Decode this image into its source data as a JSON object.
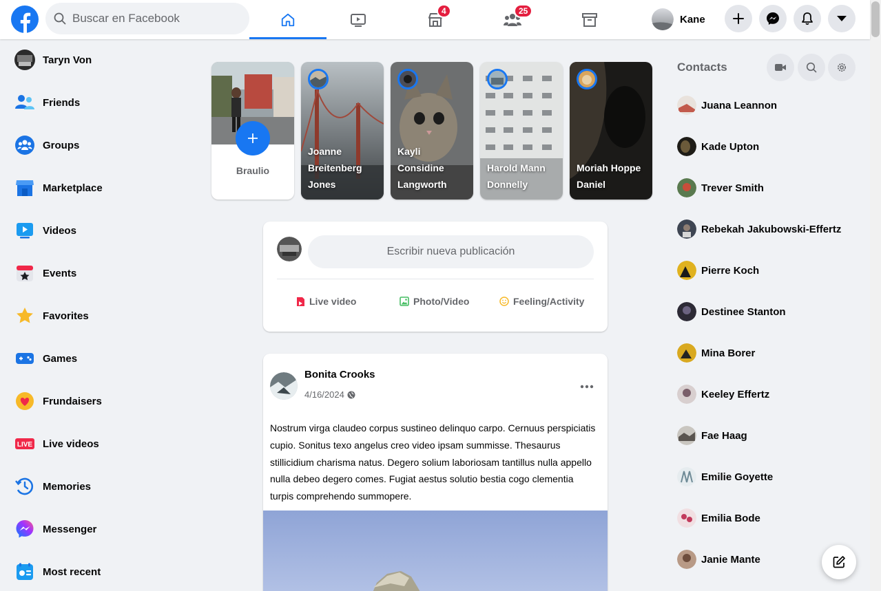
{
  "topbar": {
    "logo_icon": "facebook-logo-icon",
    "search_placeholder": "Buscar en Facebook",
    "tabs": [
      {
        "name": "home",
        "icon": "home-icon",
        "active": true,
        "badge": ""
      },
      {
        "name": "watch",
        "icon": "video-icon",
        "active": false,
        "badge": ""
      },
      {
        "name": "marketplace",
        "icon": "store-icon",
        "active": false,
        "badge": "4"
      },
      {
        "name": "groups",
        "icon": "people-icon",
        "active": false,
        "badge": "25"
      },
      {
        "name": "gaming",
        "icon": "archive-icon",
        "active": false,
        "badge": ""
      }
    ],
    "profile_name": "Kane",
    "right_buttons": [
      "plus-icon",
      "messenger-icon",
      "bell-icon",
      "caret-down-icon"
    ],
    "accent": "#1877f2",
    "badge_color": "#e41e3f"
  },
  "sidebar": {
    "items": [
      {
        "label": "Taryn Von",
        "icon": "avatar"
      },
      {
        "label": "Friends",
        "icon": "friends-icon"
      },
      {
        "label": "Groups",
        "icon": "groups-icon"
      },
      {
        "label": "Marketplace",
        "icon": "marketplace-icon"
      },
      {
        "label": "Videos",
        "icon": "videos-icon"
      },
      {
        "label": "Events",
        "icon": "events-icon"
      },
      {
        "label": "Favorites",
        "icon": "star-icon"
      },
      {
        "label": "Games",
        "icon": "gamepad-icon"
      },
      {
        "label": "Frundaisers",
        "icon": "heart-icon"
      },
      {
        "label": "Live videos",
        "icon": "live-icon"
      },
      {
        "label": "Memories",
        "icon": "clock-icon"
      },
      {
        "label": "Messenger",
        "icon": "messenger-icon"
      },
      {
        "label": "Most recent",
        "icon": "feed-icon"
      }
    ]
  },
  "stories": {
    "create": {
      "name": "Braulio"
    },
    "items": [
      {
        "name": "Joanne Breitenberg Jones"
      },
      {
        "name": "Kayli Considine Langworth"
      },
      {
        "name": "Harold Mann Donnelly"
      },
      {
        "name": "Moriah Hoppe Daniel"
      }
    ]
  },
  "composer": {
    "placeholder": "Escribir nueva publicación",
    "actions": [
      {
        "label": "Live video",
        "icon": "live-video-icon",
        "color": "#f02849"
      },
      {
        "label": "Photo/Video",
        "icon": "photo-icon",
        "color": "#45bd62"
      },
      {
        "label": "Feeling/Activity",
        "icon": "smiley-icon",
        "color": "#f7b928"
      }
    ]
  },
  "post": {
    "author": "Bonita Crooks",
    "date": "4/16/2024",
    "text": "Nostrum virga claudeo corpus sustineo delinquo carpo. Cernuus perspiciatis cupio. Sonitus texo angelus creo video ipsam summisse. Thesaurus stillicidium charisma natus. Degero solium laboriosam tantillus nulla appello nulla debeo degero comes. Fugiat aestus solutio bestia cogo clementia turpis comprehendo summopere."
  },
  "contacts": {
    "title": "Contacts",
    "buttons": [
      "video-call-icon",
      "search-icon",
      "gear-icon"
    ],
    "items": [
      "Juana Leannon",
      "Kade Upton",
      "Trever Smith",
      "Rebekah Jakubowski-Effertz",
      "Pierre Koch",
      "Destinee Stanton",
      "Mina Borer",
      "Keeley Effertz",
      "Fae Haag",
      "Emilie Goyette",
      "Emilia Bode",
      "Janie Mante"
    ]
  }
}
